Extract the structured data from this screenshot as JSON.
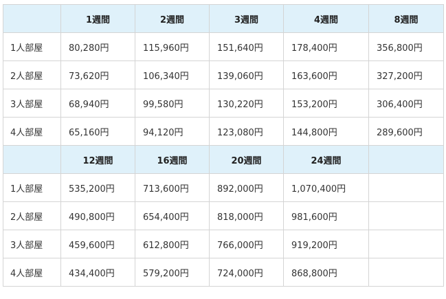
{
  "sections": [
    {
      "headers": [
        "",
        "1週間",
        "2週間",
        "3週間",
        "4週間",
        "8週間"
      ],
      "rows": [
        {
          "room": "1人部屋",
          "prices": [
            "80,280円",
            "115,960円",
            "151,640円",
            "178,400円",
            "356,800円"
          ]
        },
        {
          "room": "2人部屋",
          "prices": [
            "73,620円",
            "106,340円",
            "139,060円",
            "163,600円",
            "327,200円"
          ]
        },
        {
          "room": "3人部屋",
          "prices": [
            "68,940円",
            "99,580円",
            "130,220円",
            "153,200円",
            "306,400円"
          ]
        },
        {
          "room": "4人部屋",
          "prices": [
            "65,160円",
            "94,120円",
            "123,080円",
            "144,800円",
            "289,600円"
          ]
        }
      ]
    },
    {
      "headers": [
        "",
        "12週間",
        "16週間",
        "20週間",
        "24週間",
        ""
      ],
      "rows": [
        {
          "room": "1人部屋",
          "prices": [
            "535,200円",
            "713,600円",
            "892,000円",
            "1,070,400円",
            ""
          ]
        },
        {
          "room": "2人部屋",
          "prices": [
            "490,800円",
            "654,400円",
            "818,000円",
            "981,600円",
            ""
          ]
        },
        {
          "room": "3人部屋",
          "prices": [
            "459,600円",
            "612,800円",
            "766,000円",
            "919,200円",
            ""
          ]
        },
        {
          "room": "4人部屋",
          "prices": [
            "434,400円",
            "579,200円",
            "724,000円",
            "868,800円",
            ""
          ]
        }
      ]
    }
  ]
}
